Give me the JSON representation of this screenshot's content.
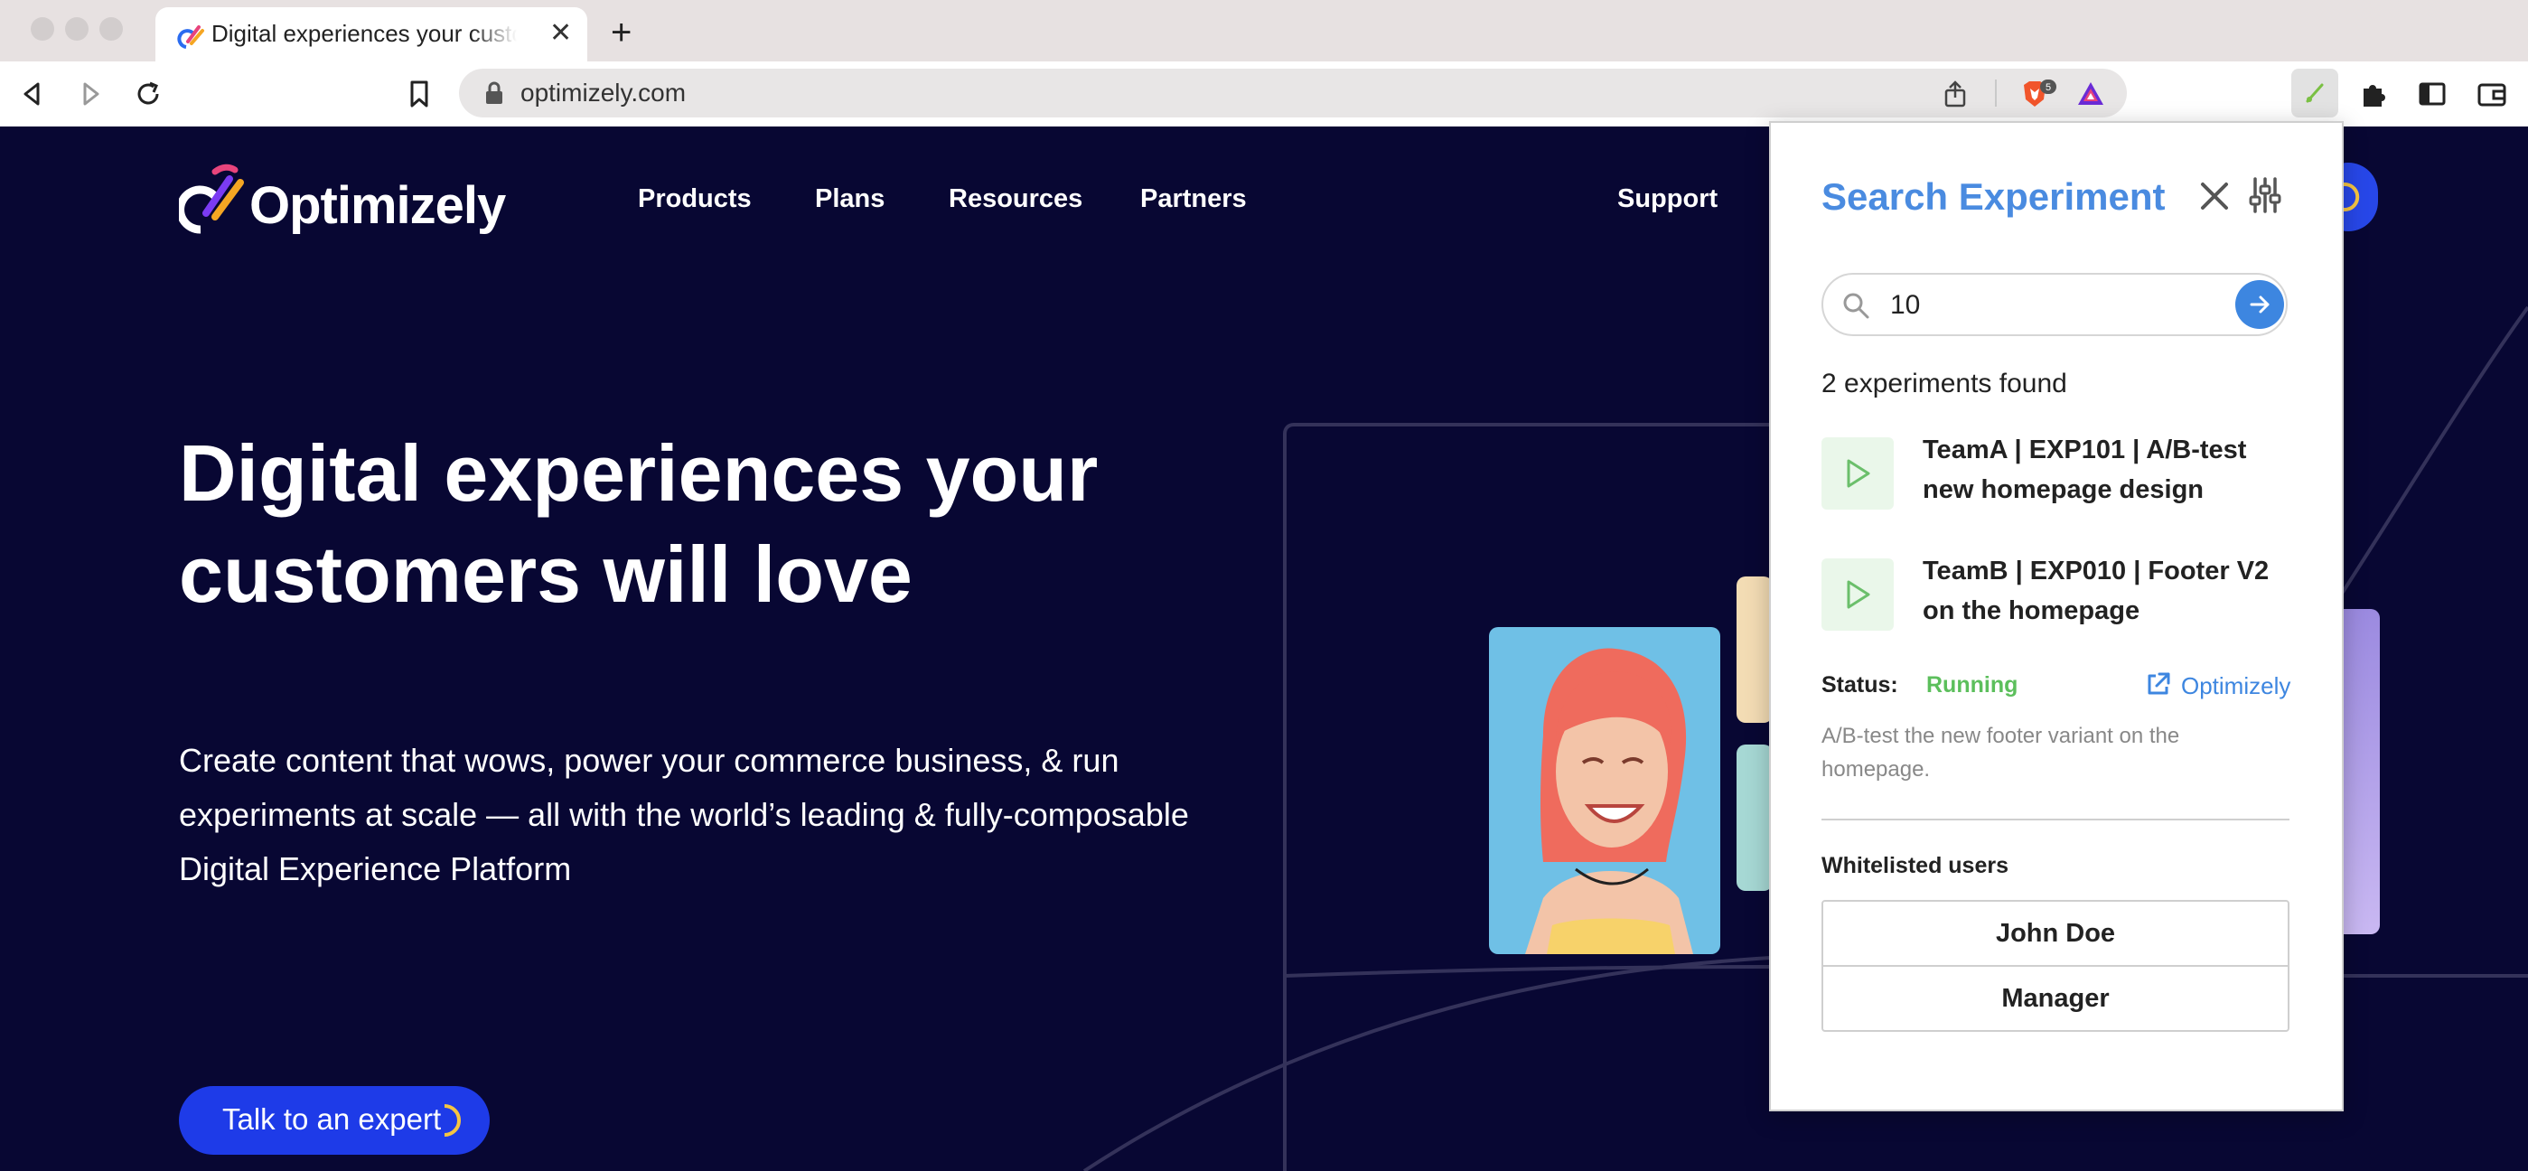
{
  "browser": {
    "tab_title": "Digital experiences your customers will love",
    "url": "optimizely.com",
    "brave_badge": "5"
  },
  "site": {
    "logo_text": "Optimizely",
    "nav": [
      "Products",
      "Plans",
      "Resources",
      "Partners"
    ],
    "support": "Support",
    "hero_title": "Digital experiences your customers will love",
    "hero_subtitle": "Create content that wows, power your commerce business, & run experiments at scale — all with the world’s leading & fully-composable Digital Experience Platform",
    "cta": "Talk to an expert"
  },
  "extension": {
    "title": "Search Experiment",
    "search_value": "10",
    "results_count_text": "2 experiments found",
    "experiments": [
      {
        "name": "TeamA | EXP101 | A/B-test new homepage design"
      },
      {
        "name": "TeamB | EXP010 | Footer V2 on the homepage"
      }
    ],
    "status_label": "Status:",
    "status_value": "Running",
    "external_link": "Optimizely",
    "description": "A/B-test the new footer variant on the homepage.",
    "whitelist_label": "Whitelisted users",
    "whitelisted_users": [
      "John Doe",
      "Manager"
    ]
  },
  "colors": {
    "page_bg": "#080733",
    "accent_blue": "#3d86e0",
    "running_green": "#5cbf5c",
    "cta_blue": "#1e3be8"
  }
}
